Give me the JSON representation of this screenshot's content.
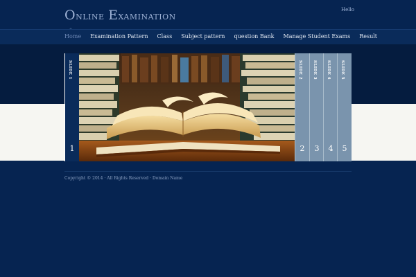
{
  "site": {
    "title_first_letter": "O",
    "title_rest1": "nline ",
    "title_second_letter": "E",
    "title_rest2": "xamination",
    "greeting": "Hello"
  },
  "nav": {
    "items": [
      {
        "label": "Home",
        "active": true
      },
      {
        "label": "Examination Pattern",
        "active": false
      },
      {
        "label": "Class",
        "active": false
      },
      {
        "label": "Subject pattern",
        "active": false
      },
      {
        "label": "question Bank",
        "active": false
      },
      {
        "label": "Manage Student Exams",
        "active": false
      },
      {
        "label": "Result",
        "active": false
      }
    ]
  },
  "slider": {
    "tabs": [
      {
        "label": "SLIDE 1",
        "number": "1"
      },
      {
        "label": "SLIDE 2",
        "number": "2"
      },
      {
        "label": "SLIDE 3",
        "number": "3"
      },
      {
        "label": "SLIDE 4",
        "number": "4"
      },
      {
        "label": "SLIDE 5",
        "number": "5"
      }
    ],
    "active_index": 0
  },
  "footer": {
    "copyright": "Copyright © 2014 · All Rights Reserved · Domain Name"
  },
  "colors": {
    "background": "#062451",
    "nav_active": "#6e88b6",
    "tab_inactive": "#7a94ad",
    "tab_active": "#0a2b5a"
  }
}
